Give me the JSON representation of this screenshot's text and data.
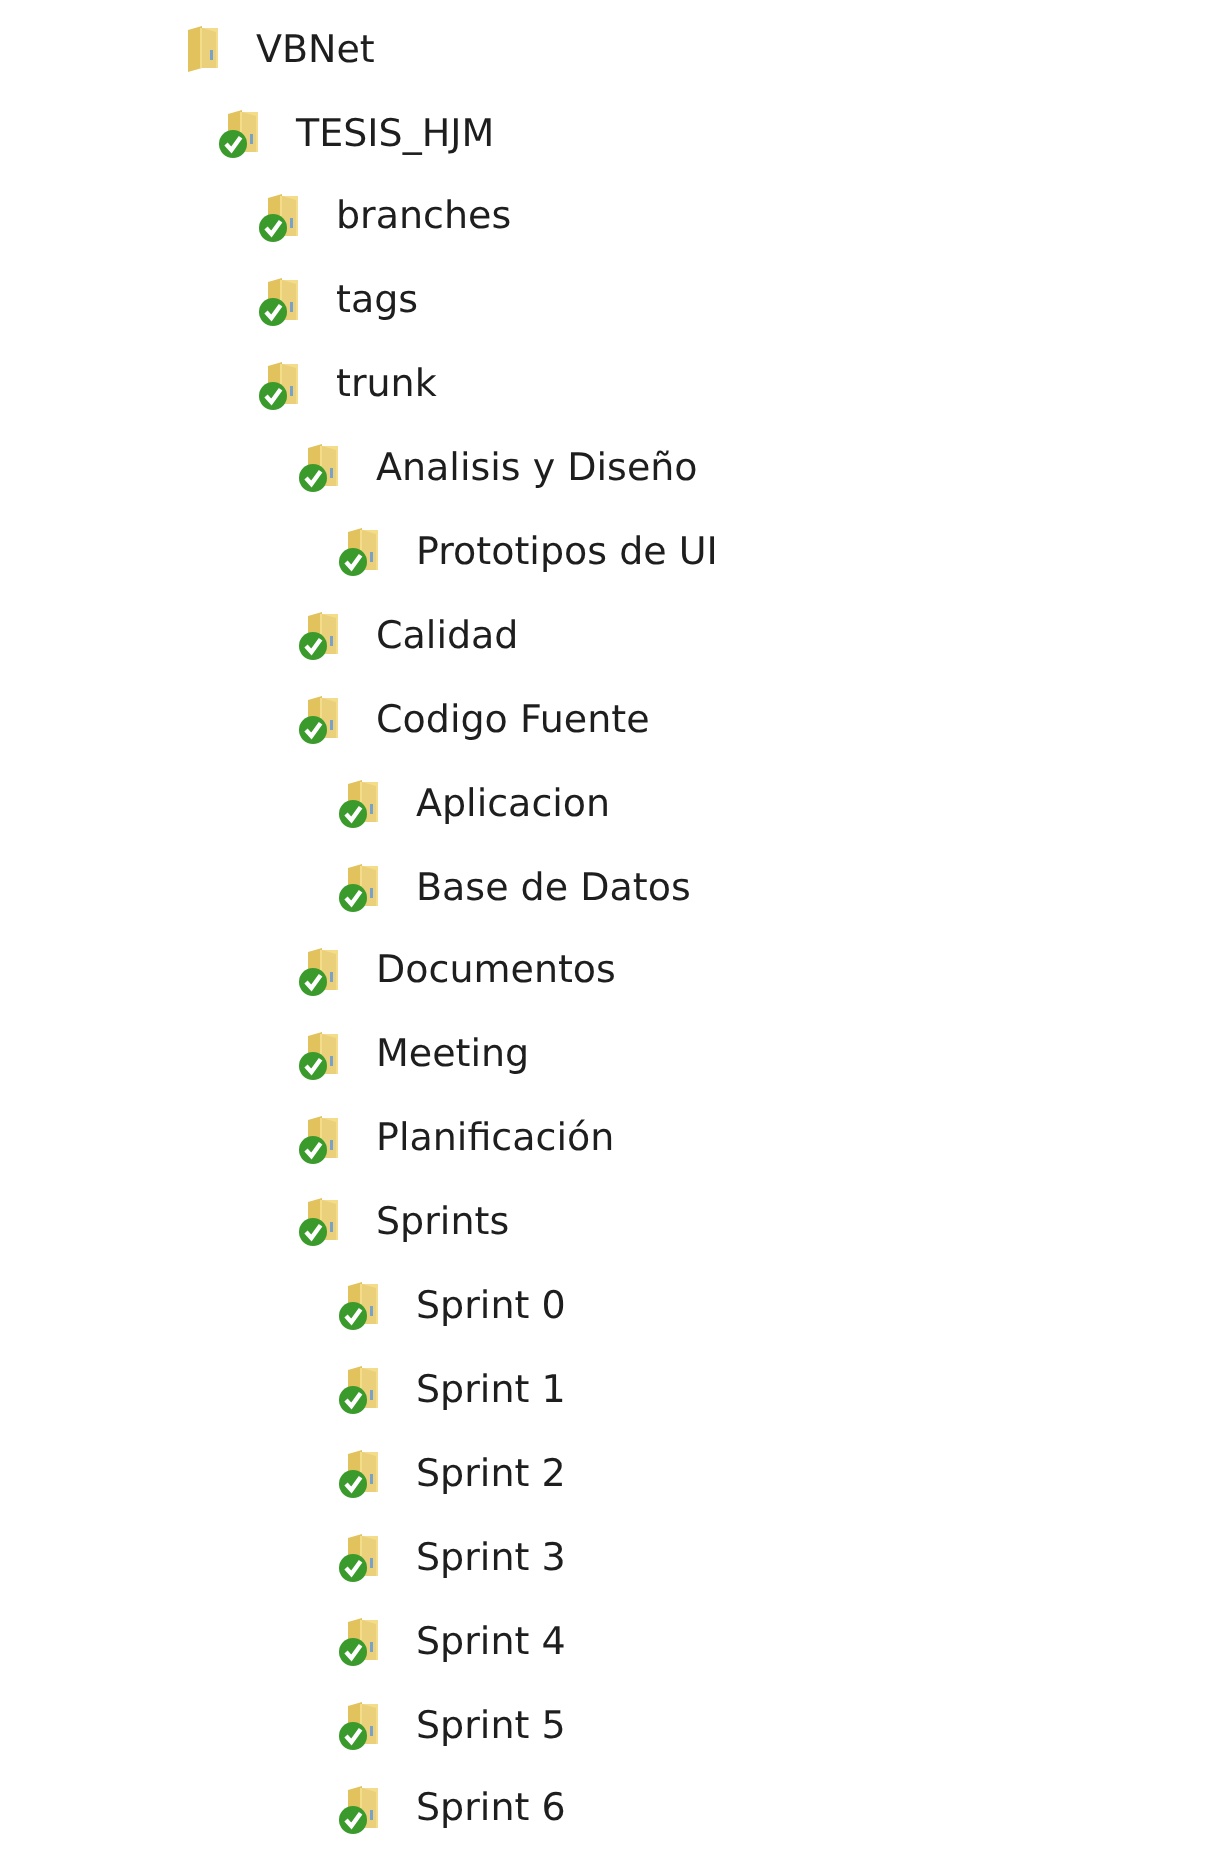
{
  "tree": [
    {
      "label": "VBNet",
      "synced": false,
      "children": [
        {
          "label": "TESIS_HJM",
          "synced": true,
          "children": [
            {
              "label": "branches",
              "synced": true
            },
            {
              "label": "tags",
              "synced": true
            },
            {
              "label": "trunk",
              "synced": true,
              "children": [
                {
                  "label": "Analisis y Diseño",
                  "synced": true,
                  "children": [
                    {
                      "label": "Prototipos de UI",
                      "synced": true
                    }
                  ]
                },
                {
                  "label": "Calidad",
                  "synced": true
                },
                {
                  "label": "Codigo Fuente",
                  "synced": true,
                  "children": [
                    {
                      "label": "Aplicacion",
                      "synced": true
                    },
                    {
                      "label": "Base de Datos",
                      "synced": true
                    }
                  ]
                },
                {
                  "label": "Documentos",
                  "synced": true
                },
                {
                  "label": "Meeting",
                  "synced": true
                },
                {
                  "label": "Planificación",
                  "synced": true
                },
                {
                  "label": "Sprints",
                  "synced": true,
                  "children": [
                    {
                      "label": "Sprint 0",
                      "synced": true
                    },
                    {
                      "label": "Sprint 1",
                      "synced": true
                    },
                    {
                      "label": "Sprint 2",
                      "synced": true
                    },
                    {
                      "label": "Sprint 3",
                      "synced": true
                    },
                    {
                      "label": "Sprint 4",
                      "synced": true
                    },
                    {
                      "label": "Sprint 5",
                      "synced": true
                    },
                    {
                      "label": "Sprint 6",
                      "synced": true
                    }
                  ]
                }
              ]
            }
          ]
        }
      ]
    }
  ]
}
